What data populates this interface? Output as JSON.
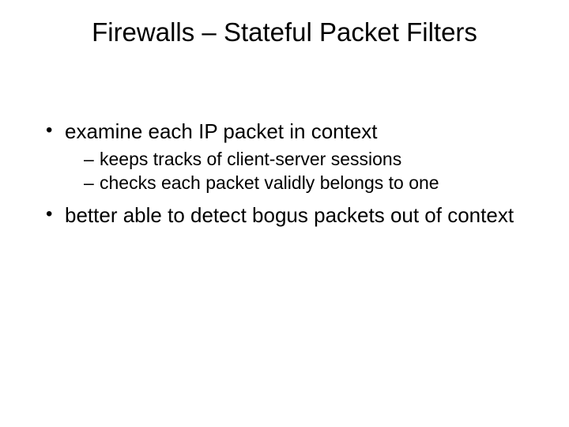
{
  "slide": {
    "title": "Firewalls – Stateful Packet Filters",
    "bullets": [
      {
        "text": "examine each IP packet in context",
        "sub": [
          "keeps tracks of client-server sessions",
          "checks each packet validly belongs to one"
        ]
      },
      {
        "text": "better able to detect bogus packets out of context",
        "sub": []
      }
    ]
  }
}
